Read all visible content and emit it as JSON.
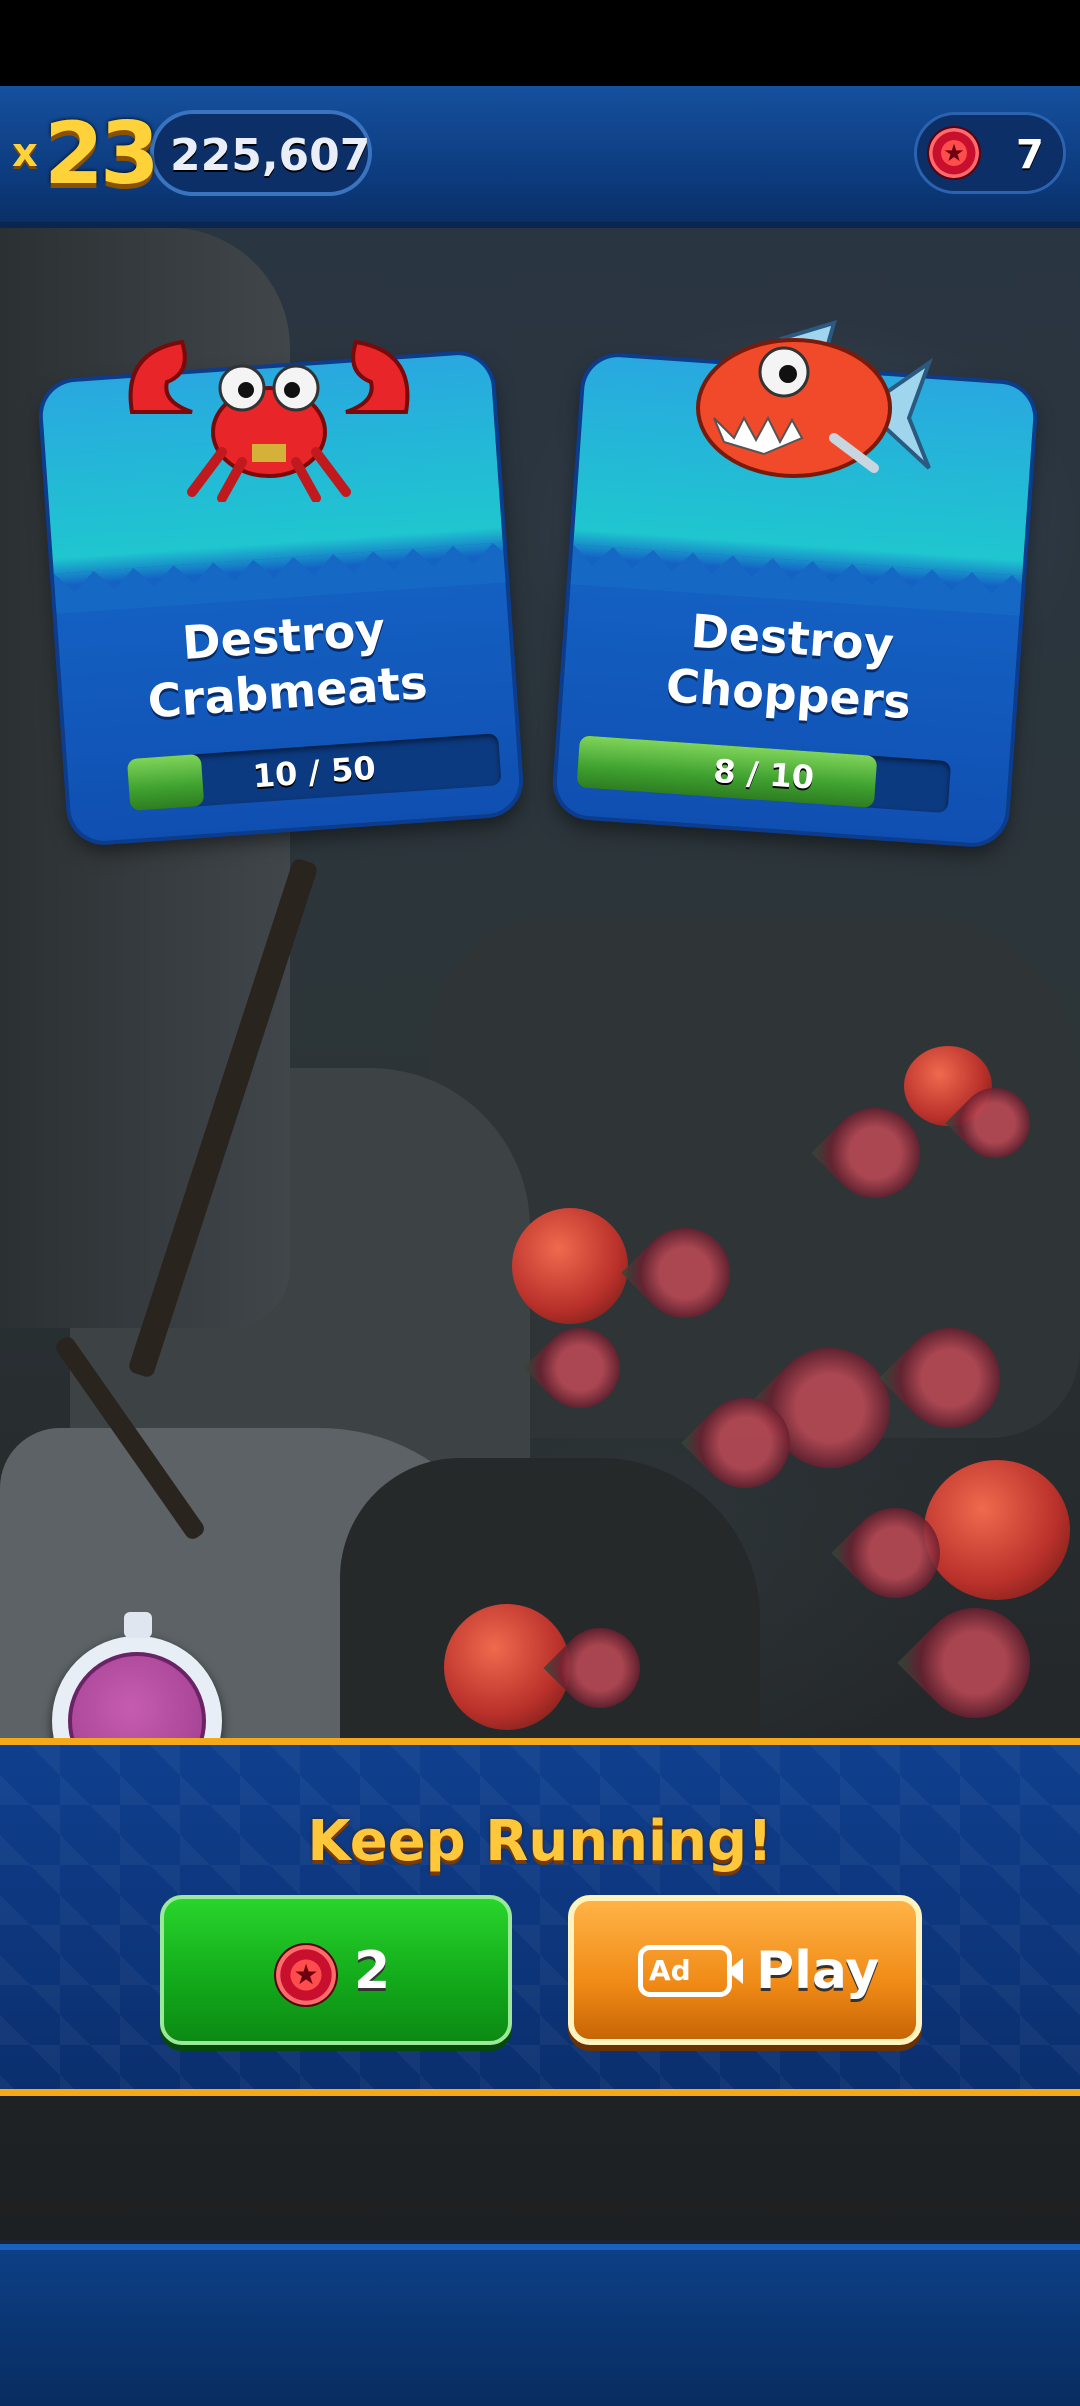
{
  "hud": {
    "multiplier_prefix": "x",
    "multiplier": "23",
    "score": "225,607",
    "red_rings": "7"
  },
  "missions": [
    {
      "title_line1": "Destroy",
      "title_line2": "Crabmeats",
      "progress_text": "10 / 50",
      "progress_fraction": 0.2,
      "icon": "crabmeat-icon"
    },
    {
      "title_line1": "Destroy",
      "title_line2": "Choppers",
      "progress_text": "8 / 10",
      "progress_fraction": 0.8,
      "icon": "chopper-icon"
    }
  ],
  "continue_panel": {
    "title": "Keep Running!",
    "rings_cost": "2",
    "ad_badge": "Ad",
    "ad_label": "Play"
  },
  "colors": {
    "accent_gold": "#f3a91a",
    "button_green": "#12a81a",
    "button_orange": "#f08a16",
    "panel_blue": "#0f3f8e"
  }
}
